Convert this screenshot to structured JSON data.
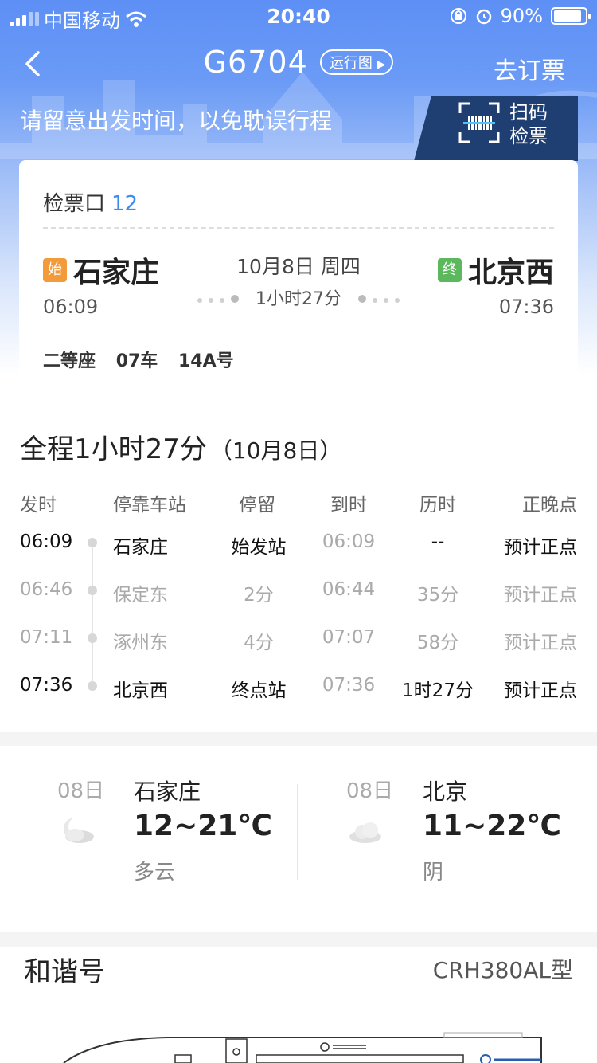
{
  "status_bar": {
    "carrier": "中国移动",
    "time": "20:40",
    "battery": "90%"
  },
  "nav": {
    "train_no": "G6704",
    "run_chart": "运行图",
    "book": "去订票"
  },
  "notice": "请留意出发时间，以免耽误行程",
  "scan": {
    "line1": "扫码",
    "line2": "检票"
  },
  "ticket": {
    "gate_label": "检票口",
    "gate_no": "12",
    "start_tag": "始",
    "end_tag": "终",
    "from": "石家庄",
    "to": "北京西",
    "date": "10月8日 周四",
    "duration": "1小时27分",
    "dep_time": "06:09",
    "arr_time": "07:36",
    "seat_class": "二等座",
    "car": "07车",
    "seat": "14A号"
  },
  "timetable": {
    "total": "全程1小时27分",
    "total_date": "（10月8日）",
    "headers": [
      "发时",
      "停靠车站",
      "停留",
      "到时",
      "历时",
      "正晚点"
    ],
    "rows": [
      {
        "dep": "06:09",
        "station": "石家庄",
        "stop": "始发站",
        "arr": "06:09",
        "elapsed": "--",
        "status": "预计正点"
      },
      {
        "dep": "06:46",
        "station": "保定东",
        "stop": "2分",
        "arr": "06:44",
        "elapsed": "35分",
        "status": "预计正点"
      },
      {
        "dep": "07:11",
        "station": "涿州东",
        "stop": "4分",
        "arr": "07:07",
        "elapsed": "58分",
        "status": "预计正点"
      },
      {
        "dep": "07:36",
        "station": "北京西",
        "stop": "终点站",
        "arr": "07:36",
        "elapsed": "1时27分",
        "status": "预计正点"
      }
    ]
  },
  "weather": [
    {
      "day": "08日",
      "city": "石家庄",
      "temp": "12~21℃",
      "cond": "多云",
      "icon": "partly-cloudy-night-icon"
    },
    {
      "day": "08日",
      "city": "北京",
      "temp": "11~22℃",
      "cond": "阴",
      "icon": "cloudy-icon"
    }
  ],
  "train": {
    "name": "和谐号",
    "model": "CRH380AL型"
  },
  "colors": {
    "accent": "#3d8af0",
    "scan_panel": "#1f3f73",
    "start_tag": "#f39a3a",
    "end_tag": "#5cb85c"
  }
}
